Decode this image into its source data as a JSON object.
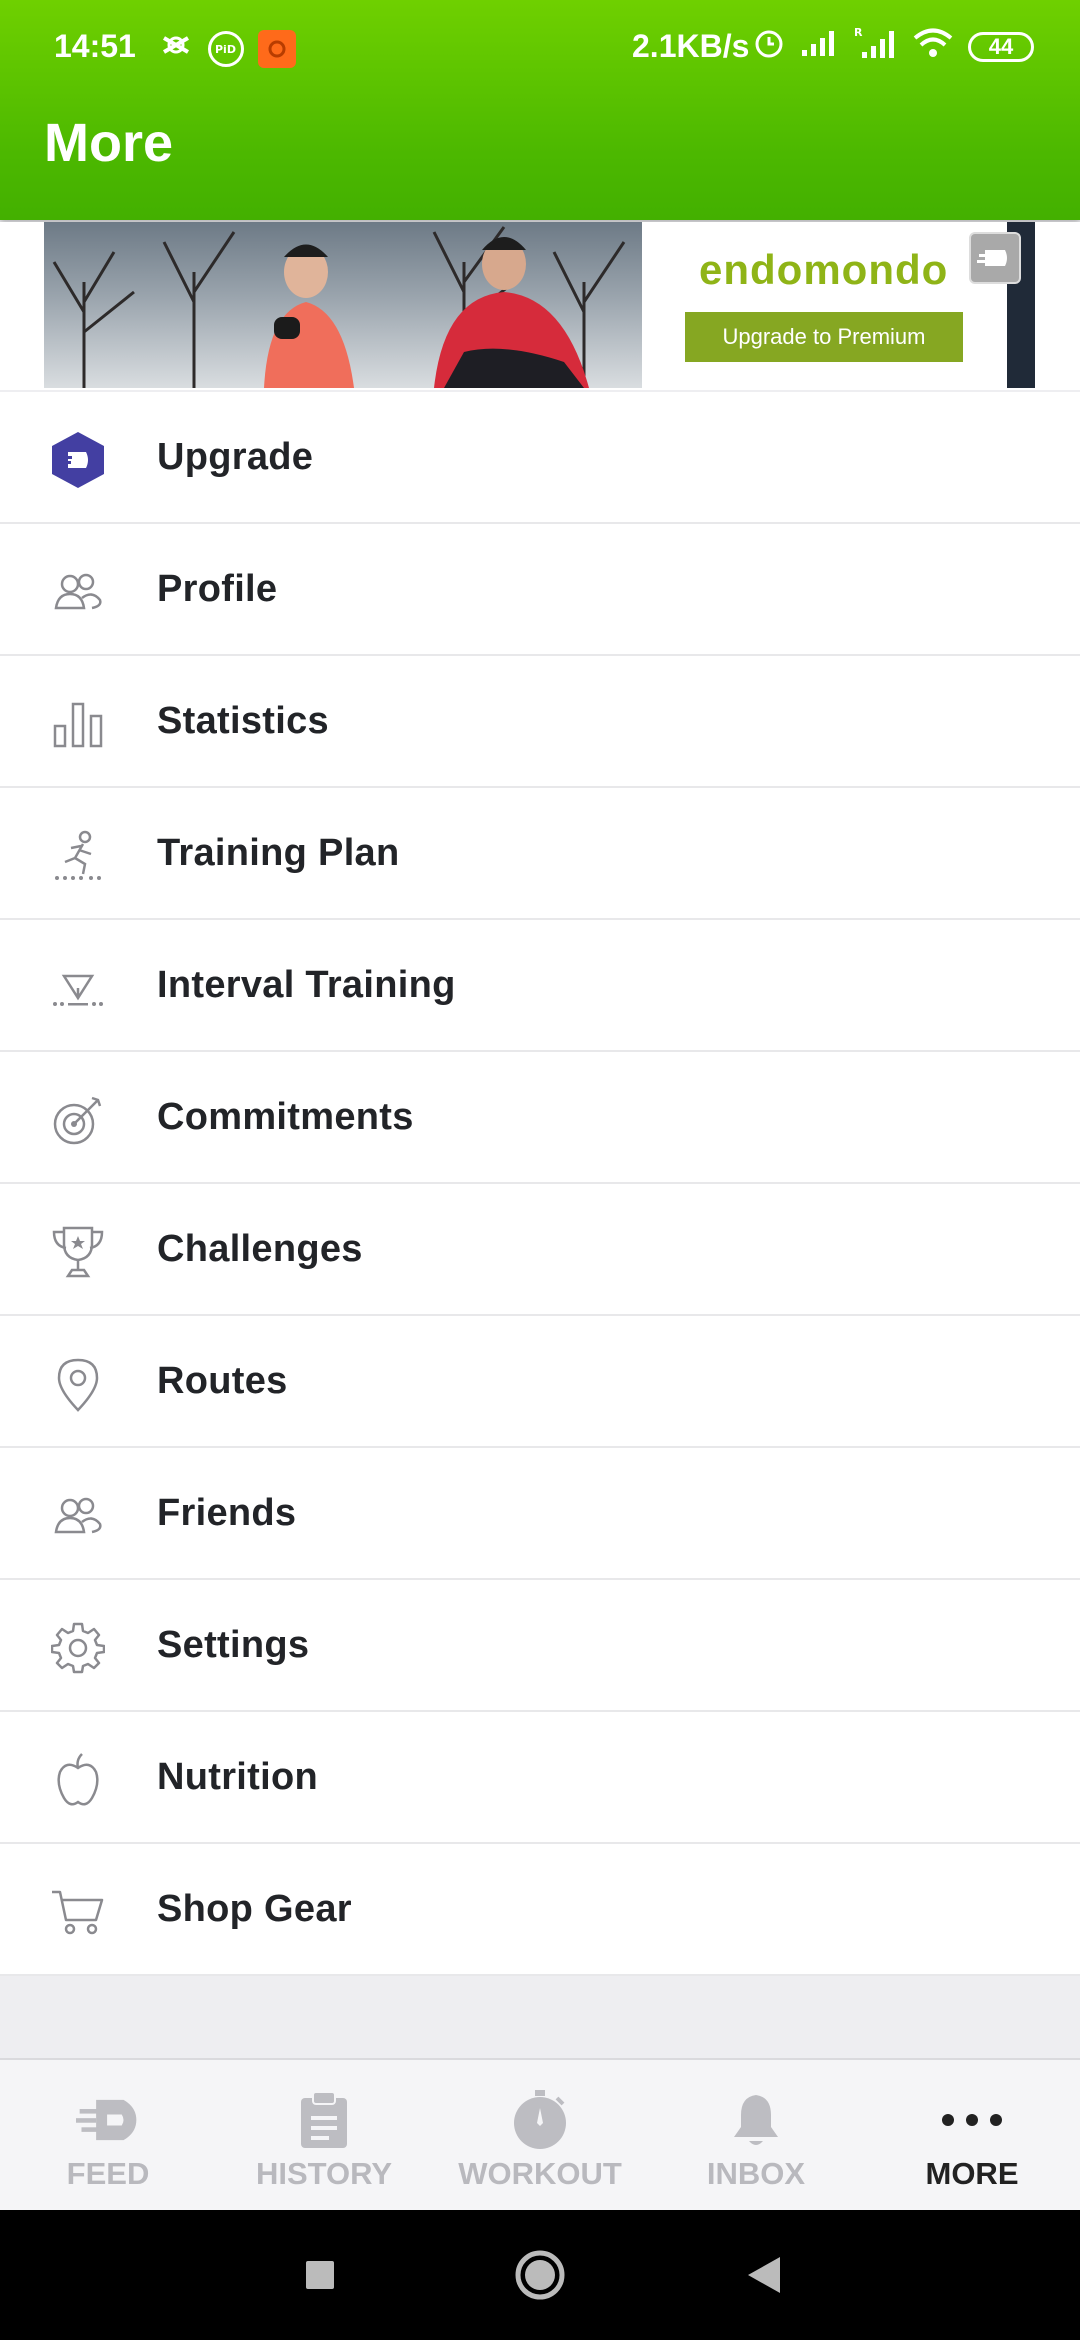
{
  "status_bar": {
    "time": "14:51",
    "net_speed": "2.1KB/s",
    "battery": "44"
  },
  "header": {
    "title": "More",
    "accent_color": "#4cb800"
  },
  "banner": {
    "brand": "endomondo",
    "cta": "Upgrade to Premium",
    "brand_color": "#8fb417"
  },
  "menu": {
    "items": [
      {
        "label": "Upgrade",
        "icon": "upgrade-hex-icon"
      },
      {
        "label": "Profile",
        "icon": "profile-icon"
      },
      {
        "label": "Statistics",
        "icon": "bar-chart-icon"
      },
      {
        "label": "Training Plan",
        "icon": "runner-icon"
      },
      {
        "label": "Interval Training",
        "icon": "interval-icon"
      },
      {
        "label": "Commitments",
        "icon": "target-icon"
      },
      {
        "label": "Challenges",
        "icon": "trophy-icon"
      },
      {
        "label": "Routes",
        "icon": "location-pin-icon"
      },
      {
        "label": "Friends",
        "icon": "friends-icon"
      },
      {
        "label": "Settings",
        "icon": "gear-icon"
      },
      {
        "label": "Nutrition",
        "icon": "apple-icon"
      },
      {
        "label": "Shop Gear",
        "icon": "cart-icon"
      }
    ]
  },
  "bottom_nav": {
    "tabs": [
      {
        "label": "FEED",
        "icon": "feed-icon",
        "active": false
      },
      {
        "label": "HISTORY",
        "icon": "clipboard-icon",
        "active": false
      },
      {
        "label": "WORKOUT",
        "icon": "stopwatch-icon",
        "active": false
      },
      {
        "label": "INBOX",
        "icon": "bell-icon",
        "active": false
      },
      {
        "label": "MORE",
        "icon": "more-dots-icon",
        "active": true
      }
    ]
  }
}
